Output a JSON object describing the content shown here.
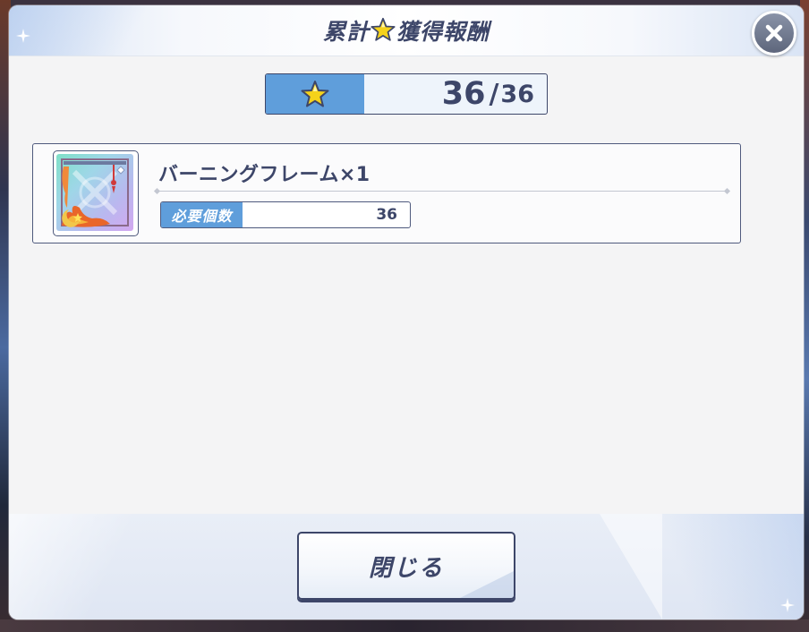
{
  "dialog": {
    "title_prefix": "累計",
    "title_suffix": "獲得報酬",
    "title_icon": "star-icon",
    "close_icon": "close-x-icon"
  },
  "progress": {
    "icon": "star-icon",
    "current": "36",
    "separator": "/",
    "total": "36"
  },
  "rewards": [
    {
      "name": "バーニングフレーム×1",
      "thumbnail_icon": "frame-item-icon",
      "requirement_label": "必要個数",
      "requirement_value": "36"
    }
  ],
  "footer": {
    "close_label": "閉じる"
  },
  "colors": {
    "accent_blue": "#5f9edb",
    "navy_text": "#3d4669",
    "panel_bg": "#f4f4f5",
    "star_yellow": "#f5d21a"
  }
}
